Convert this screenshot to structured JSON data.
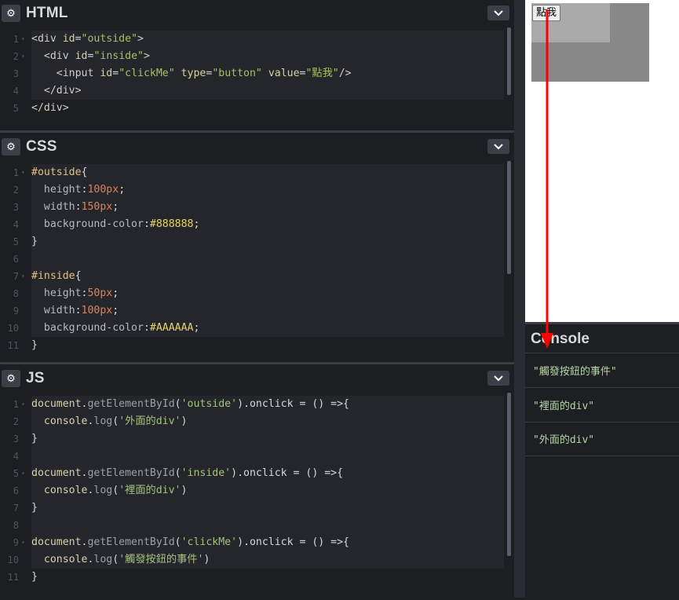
{
  "panels": {
    "html": {
      "title": "HTML"
    },
    "css": {
      "title": "CSS"
    },
    "js": {
      "title": "JS"
    }
  },
  "html_code": {
    "l1": [
      "<div ",
      "id",
      "=",
      "\"outside\"",
      ">"
    ],
    "l2": [
      "<div ",
      "id",
      "=",
      "\"inside\"",
      ">"
    ],
    "l3": [
      "<input ",
      "id",
      "=",
      "\"clickMe\"",
      " ",
      "type",
      "=",
      "\"button\"",
      " ",
      "value",
      "=",
      "\"點我\"",
      "/>"
    ],
    "l4": "</div>",
    "l5": "</div>"
  },
  "css_code": {
    "outside_sel": "#outside",
    "inside_sel": "#inside",
    "open": "{",
    "close": "}",
    "height": "height",
    "width": "width",
    "bg": "background-color",
    "colon": ":",
    "semi": ";",
    "v100px": "100px",
    "v150px": "150px",
    "v50px": "50px",
    "v100px_b": "100px",
    "hex888": "#888888",
    "hexAAA": "#AAAAAA"
  },
  "js_code": {
    "doc": "document",
    "dot": ".",
    "gebi": "getElementById",
    "paren_open": "(",
    "id_outside": "'outside'",
    "id_inside": "'inside'",
    "id_clickme": "'clickMe'",
    "onclick_tail": ").onclick = () =>{",
    "console": "console",
    "log": "log",
    "log_outside": "'外面的div'",
    "log_inside": "'裡面的div'",
    "log_clickme": "'觸發按鈕的事件'",
    "close_paren": ")",
    "brace_close": "}"
  },
  "preview": {
    "button_label": "點我"
  },
  "console": {
    "title": "Console",
    "messages": [
      "\"觸發按鈕的事件\"",
      "\"裡面的div\"",
      "\"外面的div\""
    ]
  },
  "colors": {
    "accent_arrow": "#ff0000",
    "outside_bg": "#888888",
    "inside_bg": "#AAAAAA"
  },
  "icons": {
    "panel_settings": "gear-icon",
    "panel_collapse": "chevron-down-icon"
  }
}
